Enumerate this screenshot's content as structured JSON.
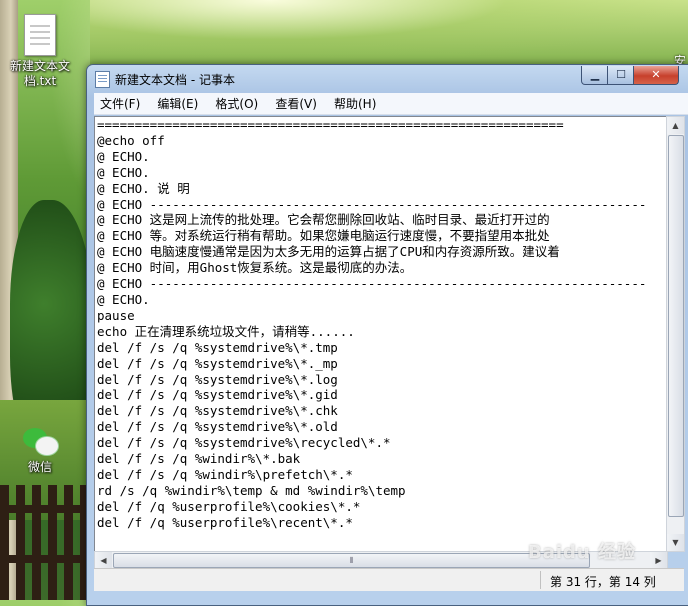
{
  "desktop": {
    "icons": [
      {
        "label": "新建文本文\n档.txt"
      },
      {
        "label": "微信"
      }
    ],
    "edge_label": "安"
  },
  "window": {
    "title": "新建文本文档 - 记事本",
    "controls": {
      "minimize": "▁",
      "maximize": "☐",
      "close": "✕"
    },
    "menu": [
      "文件(F)",
      "编辑(E)",
      "格式(O)",
      "查看(V)",
      "帮助(H)"
    ],
    "lines": [
      "==============================================================",
      "@echo off",
      "@ ECHO.",
      "@ ECHO.",
      "@ ECHO. 说 明",
      "@ ECHO ------------------------------------------------------------------",
      "@ ECHO 这是网上流传的批处理。它会帮您删除回收站、临时目录、最近打开过的",
      "@ ECHO 等。对系统运行稍有帮助。如果您嫌电脑运行速度慢，不要指望用本批处",
      "@ ECHO 电脑速度慢通常是因为太多无用的运算占据了CPU和内存资源所致。建议着",
      "@ ECHO 时间，用Ghost恢复系统。这是最彻底的办法。",
      "@ ECHO ------------------------------------------------------------------",
      "@ ECHO.",
      "pause",
      "echo 正在清理系统垃圾文件，请稍等......",
      "del /f /s /q %systemdrive%\\*.tmp",
      "del /f /s /q %systemdrive%\\*._mp",
      "del /f /s /q %systemdrive%\\*.log",
      "del /f /s /q %systemdrive%\\*.gid",
      "del /f /s /q %systemdrive%\\*.chk",
      "del /f /s /q %systemdrive%\\*.old",
      "del /f /s /q %systemdrive%\\recycled\\*.*",
      "del /f /s /q %windir%\\*.bak",
      "del /f /s /q %windir%\\prefetch\\*.*",
      "rd /s /q %windir%\\temp & md %windir%\\temp",
      "del /f /q %userprofile%\\cookies\\*.*",
      "del /f /q %userprofile%\\recent\\*.*"
    ],
    "status": {
      "position": "第 31 行，第 14 列"
    }
  },
  "watermark": "Baidu 经验"
}
